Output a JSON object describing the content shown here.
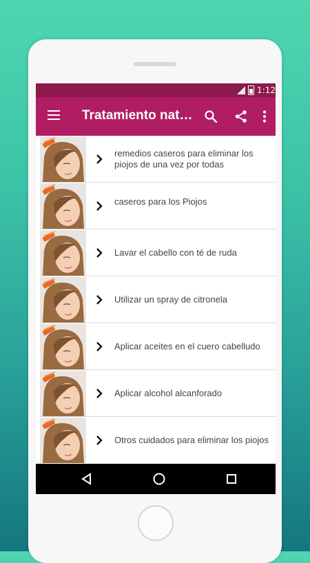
{
  "status_bar": {
    "time": "1:12"
  },
  "toolbar": {
    "title": "Tratamiento natural para los piojos",
    "menu_icon": "hamburger-menu-icon",
    "search_icon": "search-icon",
    "share_icon": "share-icon",
    "overflow_icon": "more-vert-icon"
  },
  "list": {
    "items": [
      {
        "label": "remedios caseros para eliminar los piojos de una vez por todas"
      },
      {
        "label": " caseros para los Piojos"
      },
      {
        "label": "Lavar el cabello con té de ruda"
      },
      {
        "label": "Utilizar un spray de citronela"
      },
      {
        "label": "Aplicar aceites en el cuero cabelludo"
      },
      {
        "label": "Aplicar alcohol alcanforado"
      },
      {
        "label": "Otros cuidados para eliminar los piojos"
      }
    ]
  },
  "colors": {
    "statusbar": "#8c1a4c",
    "toolbar": "#b01d62",
    "background_top": "#4fd6b0",
    "background_bottom": "#14777f"
  }
}
